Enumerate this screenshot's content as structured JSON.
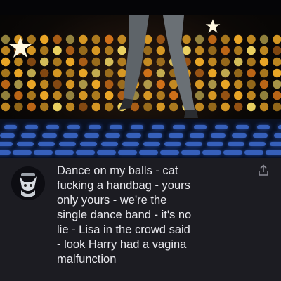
{
  "video": {
    "icons": [
      "star-icon",
      "disco-lights",
      "dance-floor"
    ]
  },
  "comment": {
    "text": "Dance on my balls - cat\nfucking a handbag - yours\nonly yours - we're the\nsingle dance band - it's no\nlie - Lisa in the crowd said\n- look Harry had a vagina\nmalfunction",
    "avatar_icon": "cat-avatar-icon",
    "share_icon": "share-icon"
  },
  "colors": {
    "background": "#1c1c22",
    "text": "#e9e9ee",
    "light_warm": "#ffb52a",
    "floor_blue": "#3f6fd6"
  }
}
